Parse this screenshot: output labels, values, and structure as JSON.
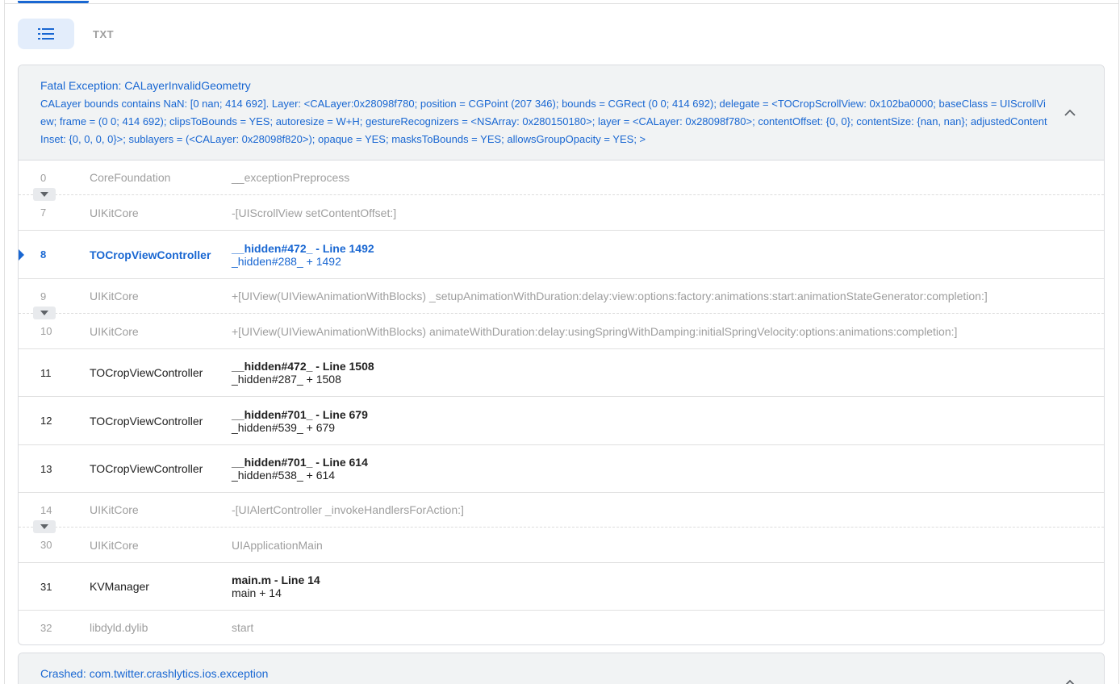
{
  "view_toggle": {
    "list_icon": "list-icon",
    "txt_label": "TXT"
  },
  "colors": {
    "accent": "#1967d2",
    "header_bg": "#f1f3f4",
    "toggle_bg": "#e3edfb"
  },
  "exceptions": [
    {
      "title": "Fatal Exception: CALayerInvalidGeometry",
      "message": "CALayer bounds contains NaN: [0 nan; 414 692]. Layer: <CALayer:0x28098f780; position = CGPoint (207 346); bounds = CGRect (0 0; 414 692); delegate = <TOCropScrollView: 0x102ba0000; baseClass = UIScrollView; frame = (0 0; 414 692); clipsToBounds = YES; autoresize = W+H; gestureRecognizers = <NSArray: 0x280150180>; layer = <CALayer: 0x28098f780>; contentOffset: {0, 0}; contentSize: {nan, nan}; adjustedContentInset: {0, 0, 0, 0}>; sublayers = (<CALayer: 0x28098f820>); opaque = YES; masksToBounds = YES; allowsGroupOpacity = YES; >",
      "frames": [
        {
          "num": "0",
          "lib": "CoreFoundation",
          "symbol": "__exceptionPreprocess"
        },
        {
          "num": "7",
          "lib": "UIKitCore",
          "symbol": "-[UIScrollView setContentOffset:]"
        },
        {
          "num": "8",
          "lib": "TOCropViewController",
          "symbol": "__hidden#472_ - Line 1492",
          "sub": "_hidden#288_ + 1492"
        },
        {
          "num": "9",
          "lib": "UIKitCore",
          "symbol": "+[UIView(UIViewAnimationWithBlocks) _setupAnimationWithDuration:delay:view:options:factory:animations:start:animationStateGenerator:completion:]"
        },
        {
          "num": "10",
          "lib": "UIKitCore",
          "symbol": "+[UIView(UIViewAnimationWithBlocks) animateWithDuration:delay:usingSpringWithDamping:initialSpringVelocity:options:animations:completion:]"
        },
        {
          "num": "11",
          "lib": "TOCropViewController",
          "symbol": "__hidden#472_ - Line 1508",
          "sub": "_hidden#287_ + 1508"
        },
        {
          "num": "12",
          "lib": "TOCropViewController",
          "symbol": "__hidden#701_ - Line 679",
          "sub": "_hidden#539_ + 679"
        },
        {
          "num": "13",
          "lib": "TOCropViewController",
          "symbol": "__hidden#701_ - Line 614",
          "sub": "_hidden#538_ + 614"
        },
        {
          "num": "14",
          "lib": "UIKitCore",
          "symbol": "-[UIAlertController _invokeHandlersForAction:]"
        },
        {
          "num": "30",
          "lib": "UIKitCore",
          "symbol": "UIApplicationMain"
        },
        {
          "num": "31",
          "lib": "KVManager",
          "symbol": "main.m - Line 14",
          "sub": "main + 14"
        },
        {
          "num": "32",
          "lib": "libdyld.dylib",
          "symbol": "start"
        }
      ]
    },
    {
      "title": "Crashed: com.twitter.crashlytics.ios.exception"
    }
  ]
}
